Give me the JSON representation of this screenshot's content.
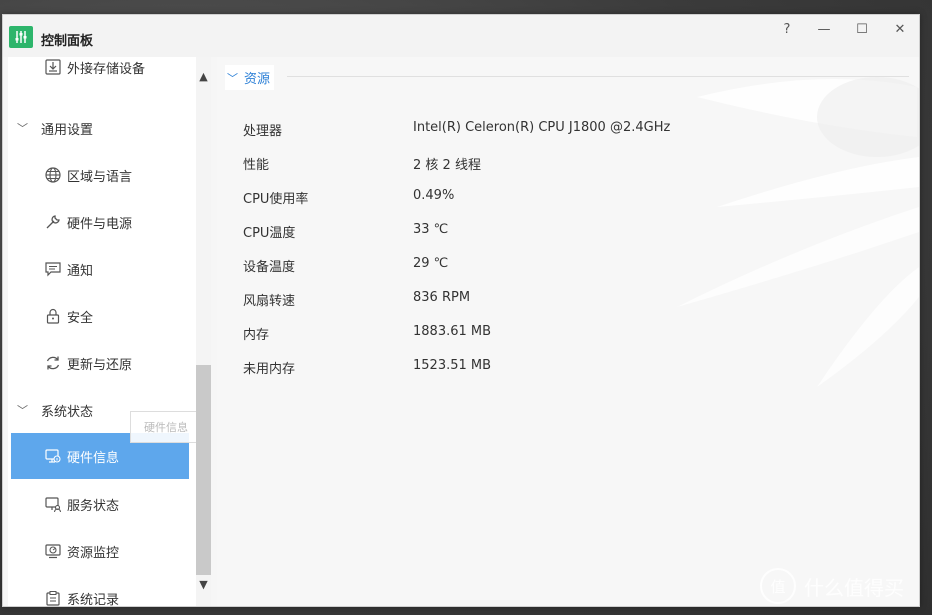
{
  "window": {
    "title": "控制面板",
    "app_icon": "control-panel-icon",
    "controls": {
      "help": "?",
      "minimize": "—",
      "maximize": "☐",
      "close": "✕"
    }
  },
  "sidebar": {
    "top_item": {
      "label": "外接存储设备",
      "icon": "external-storage-icon"
    },
    "groups": [
      {
        "label": "通用设置",
        "items": [
          {
            "label": "区域与语言",
            "icon": "globe-icon"
          },
          {
            "label": "硬件与电源",
            "icon": "wrench-icon"
          },
          {
            "label": "通知",
            "icon": "message-icon"
          },
          {
            "label": "安全",
            "icon": "lock-icon"
          },
          {
            "label": "更新与还原",
            "icon": "refresh-icon"
          }
        ]
      },
      {
        "label": "系统状态",
        "items": [
          {
            "label": "硬件信息",
            "icon": "hardware-info-icon",
            "active": true
          },
          {
            "label": "服务状态",
            "icon": "service-status-icon"
          },
          {
            "label": "资源监控",
            "icon": "resource-monitor-icon"
          },
          {
            "label": "系统记录",
            "icon": "system-log-icon"
          }
        ]
      }
    ],
    "tooltip": "硬件信息"
  },
  "content": {
    "section_title": "资源",
    "rows": [
      {
        "key": "处理器",
        "value": "Intel(R) Celeron(R) CPU J1800 @2.4GHz"
      },
      {
        "key": "性能",
        "value": "2 核 2 线程"
      },
      {
        "key": "CPU使用率",
        "value": "0.49%"
      },
      {
        "key": "CPU温度",
        "value": "33 ℃"
      },
      {
        "key": "设备温度",
        "value": "29 ℃"
      },
      {
        "key": "风扇转速",
        "value": "836 RPM"
      },
      {
        "key": "内存",
        "value": "1883.61 MB"
      },
      {
        "key": "未用内存",
        "value": "1523.51 MB"
      }
    ]
  },
  "watermark": {
    "mark": "值",
    "text": "什么值得买"
  },
  "colors": {
    "accent": "#5ea7ec",
    "link": "#2b7fd6",
    "app_icon": "#2db56b"
  }
}
